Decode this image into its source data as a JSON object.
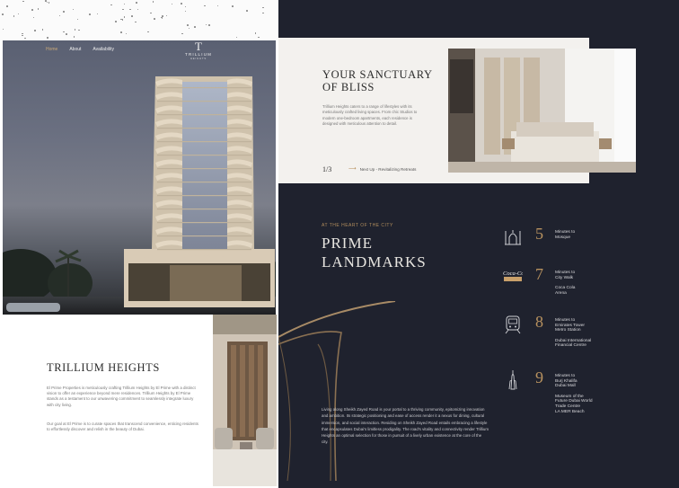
{
  "nav": {
    "home": "Home",
    "about": "About",
    "availability": "Availability"
  },
  "brand": {
    "name": "TRILLIUM",
    "sub": "HEIGHTS"
  },
  "trillium": {
    "title": "TRILLIUM HEIGHTS",
    "p1": "El Prime Properties is meticulously crafting Trillium Heights by El Prime with a distinct vision to offer an experience beyond mere residences. Trillium Heights by El Prime stands as a testament to our unwavering commitment to seamlessly integrate luxury with city living.",
    "p2": "Our goal at El Prime is to curate spaces that transcend convenience, enticing residents to effortlessly discover and relish in the beauty of Dubai."
  },
  "sanctuary": {
    "title": "YOUR SANCTUARY OF BLISS",
    "para": "Trillium Heights caters to a range of lifestyles with its meticulously crafted living spaces. From chic Studios to modern one-bedroom apartments, each residence is designed with meticulous attention to detail.",
    "counter": "1/3",
    "next": "Next Up - Revitalizing Retreats"
  },
  "landmarks": {
    "eyebrow": "AT THE HEART OF THE CITY",
    "title": "PRIME LANDMARKS",
    "para": "Living along Sheikh Zayed Road is your portal to a thriving community, epitomizing innovation and ambition. Its strategic positioning and ease of access render it a nexus for dining, cultural immersion, and social interaction. Residing on Sheikh Zayed Road entails embracing a lifestyle that encapsulates Dubai's limitless prodigality. The road's vitality and connectivity render Trillium Heights an optimal selection for those in pursuit of a lively urban existence at the core of the city.",
    "items": [
      {
        "num": "5",
        "icon": "mosque-icon",
        "line1": "Minutes to",
        "line2": "Mosque",
        "line3": "",
        "line4": "",
        "line5": "",
        "line6": ""
      },
      {
        "num": "7",
        "icon": "coca-cola-icon",
        "line1": "Minutes to",
        "line2": "City Walk",
        "line3": "Coca Cola",
        "line4": "Arena",
        "line5": "",
        "line6": ""
      },
      {
        "num": "8",
        "icon": "metro-train-icon",
        "line1": "Minutes to",
        "line2": "Emirates Tower",
        "line3": "Metro Station",
        "line4": "Dubai International",
        "line5": "Financial Centre",
        "line6": ""
      },
      {
        "num": "9",
        "icon": "burj-khalifa-icon",
        "line1": "Minutes to",
        "line2": "Burj Khalifa",
        "line3": "Dubai Mall",
        "line4": "Museum of the",
        "line5": "Future Dubai World",
        "line6": "Trade Centre",
        "line7": "LA MER Beach"
      }
    ],
    "cola_logo": "Coca-Cola"
  },
  "colors": {
    "accent": "#b8925f",
    "dark": "#1f222e",
    "light_card": "#f3f1ee"
  }
}
